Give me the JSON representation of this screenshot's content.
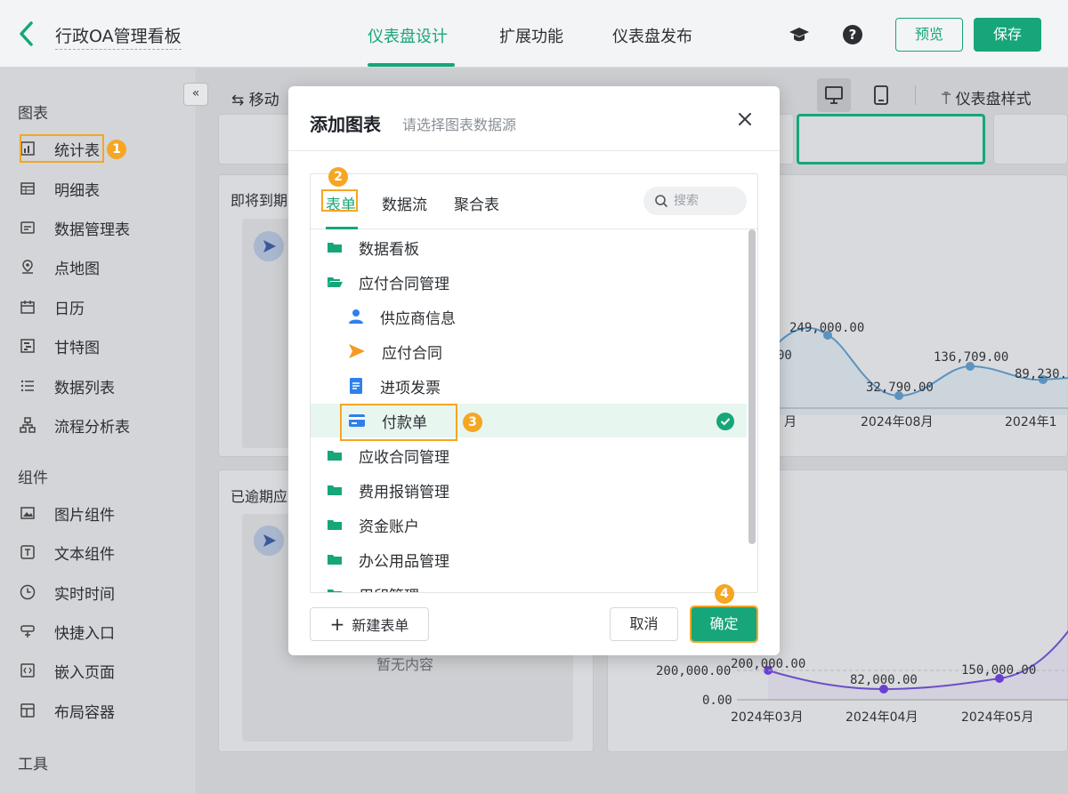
{
  "header": {
    "app_title": "行政OA管理看板",
    "tabs": [
      "仪表盘设计",
      "扩展功能",
      "仪表盘发布"
    ],
    "preview_label": "预览",
    "save_label": "保存"
  },
  "sidebar": {
    "section_charts": "图表",
    "charts": [
      {
        "label": "统计表",
        "icon": "stat-table-icon"
      },
      {
        "label": "明细表",
        "icon": "detail-table-icon"
      },
      {
        "label": "数据管理表",
        "icon": "data-manage-icon"
      },
      {
        "label": "点地图",
        "icon": "map-pin-icon"
      },
      {
        "label": "日历",
        "icon": "calendar-icon"
      },
      {
        "label": "甘特图",
        "icon": "gantt-icon"
      },
      {
        "label": "数据列表",
        "icon": "list-icon"
      },
      {
        "label": "流程分析表",
        "icon": "flow-icon"
      }
    ],
    "section_components": "组件",
    "components": [
      {
        "label": "图片组件",
        "icon": "image-icon"
      },
      {
        "label": "文本组件",
        "icon": "text-icon"
      },
      {
        "label": "实时时间",
        "icon": "clock-icon"
      },
      {
        "label": "快捷入口",
        "icon": "shortcut-icon"
      },
      {
        "label": "嵌入页面",
        "icon": "embed-icon"
      },
      {
        "label": "布局容器",
        "icon": "layout-icon"
      }
    ],
    "section_tools": "工具"
  },
  "toolbar": {
    "move_label": "移动",
    "style_label": "仪表盘样式"
  },
  "canvas": {
    "card1_title": "即将到期",
    "card2_title": "已逾期应",
    "empty_text": "暂无内容"
  },
  "chart_top": {
    "value_labels": [
      "249,000.00",
      "00",
      "136,709.00",
      "89,230.",
      "32,790.00"
    ],
    "x_labels": [
      "月",
      "2024年08月",
      "2024年1"
    ]
  },
  "chart_bottom": {
    "value_labels": [
      "200,000.00",
      "82,000.00",
      "150,000.00"
    ],
    "y_labels": [
      "200,000.00",
      "0.00"
    ],
    "x_labels": [
      "2024年03月",
      "2024年04月",
      "2024年05月"
    ]
  },
  "modal": {
    "title": "添加图表",
    "subtitle": "请选择图表数据源",
    "tabs": [
      "表单",
      "数据流",
      "聚合表"
    ],
    "search_placeholder": "搜索",
    "tree": [
      {
        "label": "数据看板",
        "type": "folder"
      },
      {
        "label": "应付合同管理",
        "type": "folder-open"
      },
      {
        "label": "供应商信息",
        "type": "form-user"
      },
      {
        "label": "应付合同",
        "type": "form-send"
      },
      {
        "label": "进项发票",
        "type": "form-doc"
      },
      {
        "label": "付款单",
        "type": "form-card",
        "selected": true
      },
      {
        "label": "应收合同管理",
        "type": "folder"
      },
      {
        "label": "费用报销管理",
        "type": "folder"
      },
      {
        "label": "资金账户",
        "type": "folder"
      },
      {
        "label": "办公用品管理",
        "type": "folder"
      },
      {
        "label": "用印管理",
        "type": "folder"
      }
    ],
    "new_form_label": "新建表单",
    "cancel_label": "取消",
    "ok_label": "确定"
  },
  "steps": [
    "1",
    "2",
    "3",
    "4"
  ],
  "colors": {
    "accent": "#16a67a",
    "highlight": "#f5a623"
  }
}
